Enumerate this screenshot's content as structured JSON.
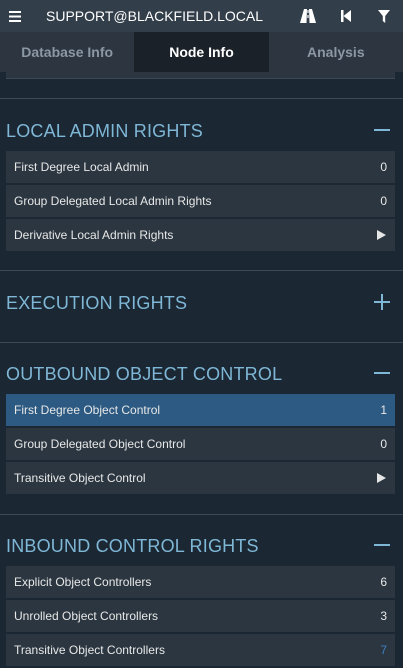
{
  "header": {
    "title": "SUPPORT@BLACKFIELD.LOCAL"
  },
  "tabs": [
    {
      "label": "Database Info"
    },
    {
      "label": "Node Info"
    },
    {
      "label": "Analysis"
    }
  ],
  "sections": {
    "local_admin": {
      "title": "LOCAL ADMIN RIGHTS",
      "rows": [
        {
          "label": "First Degree Local Admin",
          "value": "0"
        },
        {
          "label": "Group Delegated Local Admin Rights",
          "value": "0"
        },
        {
          "label": "Derivative Local Admin Rights",
          "value": ""
        }
      ]
    },
    "execution": {
      "title": "EXECUTION RIGHTS"
    },
    "outbound": {
      "title": "OUTBOUND OBJECT CONTROL",
      "rows": [
        {
          "label": "First Degree Object Control",
          "value": "1"
        },
        {
          "label": "Group Delegated Object Control",
          "value": "0"
        },
        {
          "label": "Transitive Object Control",
          "value": ""
        }
      ]
    },
    "inbound": {
      "title": "INBOUND CONTROL RIGHTS",
      "rows": [
        {
          "label": "Explicit Object Controllers",
          "value": "6"
        },
        {
          "label": "Unrolled Object Controllers",
          "value": "3"
        },
        {
          "label": "Transitive Object Controllers",
          "value": "7"
        }
      ]
    }
  },
  "colors": {
    "accent": "#7fb7d6",
    "highlight_row": "#2c5a82",
    "link": "#3f7fc0"
  }
}
